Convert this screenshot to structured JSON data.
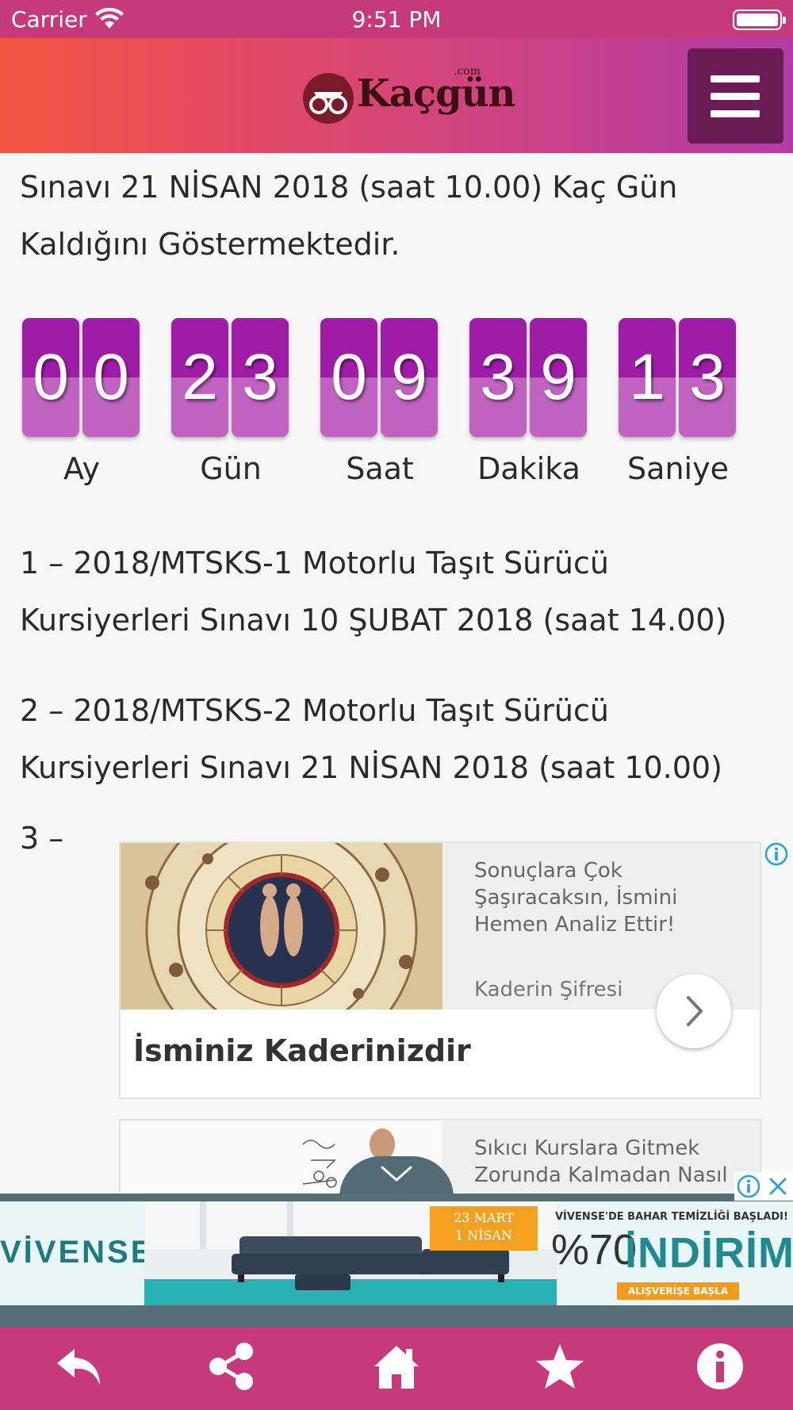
{
  "status_bar": {
    "carrier": "Carrier",
    "time": "9:51 PM"
  },
  "header": {
    "logo_text": "Kaçgün",
    "logo_suffix": ".com",
    "menu_icon": "hamburger-menu-icon"
  },
  "content": {
    "intro_lines": [
      "Sınavı 21 NİSAN 2018 (saat 10.00) Kaç Gün",
      "Kaldığını Göstermektedir."
    ],
    "countdown": [
      {
        "label": "Ay",
        "digits": [
          "0",
          "0"
        ]
      },
      {
        "label": "Gün",
        "digits": [
          "2",
          "3"
        ]
      },
      {
        "label": "Saat",
        "digits": [
          "0",
          "9"
        ]
      },
      {
        "label": "Dakika",
        "digits": [
          "3",
          "9"
        ]
      },
      {
        "label": "Saniye",
        "digits": [
          "1",
          "3"
        ]
      }
    ],
    "items": [
      {
        "line1": "1 – 2018/MTSKS-1 Motorlu Taşıt Sürücü",
        "line2": "Kursiyerleri Sınavı 10 ŞUBAT 2018 (saat 14.00)"
      },
      {
        "line1": "2 – 2018/MTSKS-2 Motorlu Taşıt Sürücü",
        "line2": "Kursiyerleri Sınavı 21 NİSAN 2018 (saat 10.00)"
      }
    ],
    "item_three": "3 –"
  },
  "ads": [
    {
      "description": "Sonuçlara Çok Şaşıracaksın, İsmini Hemen Analiz Ettir!",
      "source": "Kaderin Şifresi",
      "title": "İsminiz Kaderinizdir"
    },
    {
      "description": "Sıkıcı Kurslara Gitmek Zorunda Kalmadan Nasıl"
    }
  ],
  "banner": {
    "brand": "VİVENSE",
    "date_line1": "23 MART",
    "date_line2": "1 NİSAN",
    "headline": "VİVENSE'DE BAHAR TEMİZLİĞİ BAŞLADI!",
    "percent": "%70",
    "discount": "İNDİRİM",
    "cta": "ALIŞVERİŞE BAŞLA"
  },
  "tab_bar": [
    {
      "icon": "back-icon"
    },
    {
      "icon": "share-icon"
    },
    {
      "icon": "home-icon"
    },
    {
      "icon": "star-icon"
    },
    {
      "icon": "info-icon"
    }
  ],
  "colors": {
    "status_bar": "#c63a7b",
    "header_start": "#f35640",
    "header_end": "#b23ca7",
    "menu_button": "#6a1c55",
    "digit_top": "#9f1ca7",
    "digit_bottom": "#c063c0",
    "tab_bar": "#c63a7b"
  }
}
